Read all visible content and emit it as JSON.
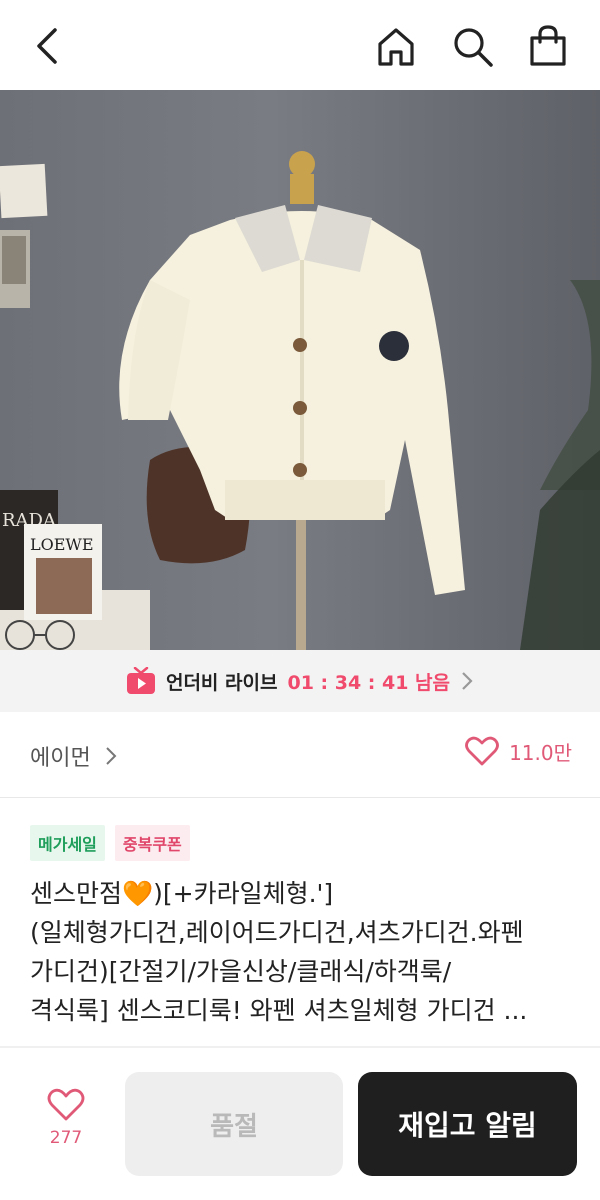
{
  "header": {
    "back_icon": "chevron-left-icon",
    "home_icon": "home-icon",
    "search_icon": "search-icon",
    "cart_icon": "shopping-bag-icon"
  },
  "gallery": {
    "total_images": 4,
    "active_index": 0,
    "product_image": "cream knit cardigan with striped collar on mannequin",
    "poster_text": "LOEWE",
    "magazine_text": "RADA",
    "expand_icon": "expand-icon"
  },
  "live": {
    "icon": "live-tv-icon",
    "label": "언더비 라이브",
    "countdown": "01 : 34 : 41 남음",
    "arrow_icon": "chevron-right-icon"
  },
  "shop": {
    "name": "에이먼",
    "like_count": "11.0만",
    "heart_color": "#e05a78"
  },
  "badges": {
    "mega_sale": "메가세일",
    "double_coupon": "중복쿠폰"
  },
  "product": {
    "title_lines": [
      "센스만점🧡)[+카라일체형.'] ",
      "(일체형가디건,레이어드가디건,셔츠가디건.와펜",
      "가디건)[간절기/가을신상/클래식/하객룩/",
      "격식룩] 센스코디룩! 와펜 셔츠일체형 가디건 ..."
    ]
  },
  "bottom_bar": {
    "wish_count": "277",
    "soldout_label": "품절",
    "restock_label": "재입고 알림"
  },
  "colors": {
    "accent": "#f04a6c",
    "dark_button": "#1f1f1f",
    "disabled_button": "#eeeeee",
    "mega_green": "#1e9e5a",
    "coupon_pink": "#e0476a"
  }
}
